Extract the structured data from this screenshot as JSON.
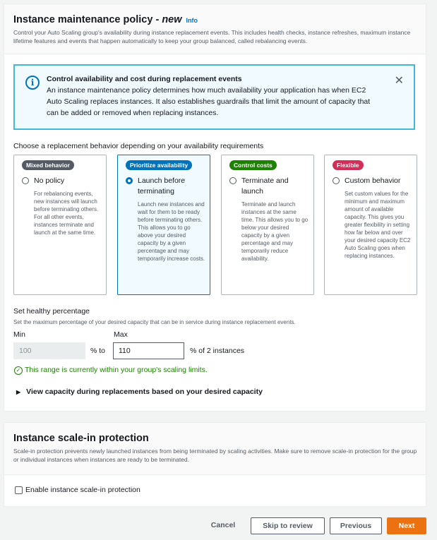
{
  "maintenance": {
    "title": "Instance maintenance policy - ",
    "title_new": "new",
    "info_link": "Info",
    "description": "Control your Auto Scaling group's availability during instance replacement events. This includes health checks, instance refreshes, maximum instance lifetime features and events that happen automatically to keep your group balanced, called rebalancing events.",
    "alert": {
      "title": "Control availability and cost during replacement events",
      "body": "An instance maintenance policy determines how much availability your application has when EC2 Auto Scaling replaces instances. It also establishes guardrails that limit the amount of capacity that can be added or removed when replacing instances.",
      "close_glyph": "✕",
      "icon_glyph": "i"
    },
    "choose_label": "Choose a replacement behavior depending on your availability requirements",
    "options": [
      {
        "badge": "Mixed behavior",
        "badge_color": "#545b64",
        "title": "No policy",
        "description": "For rebalancing events, new instances will launch before terminating others. For all other events, instances terminate and launch at the same time.",
        "selected": false
      },
      {
        "badge": "Prioritize availability",
        "badge_color": "#0073bb",
        "title": "Launch before terminating",
        "description": "Launch new instances and wait for them to be ready before terminating others. This allows you to go above your desired capacity by a given percentage and may temporarily increase costs.",
        "selected": true
      },
      {
        "badge": "Control costs",
        "badge_color": "#1d8102",
        "title": "Terminate and launch",
        "description": "Terminate and launch instances at the same time. This allows you to go below your desired capacity by a given percentage and may temporarily reduce availability.",
        "selected": false
      },
      {
        "badge": "Flexible",
        "badge_color": "#d12f59",
        "title": "Custom behavior",
        "description": "Set custom values for the minimum and maximum amount of available capacity. This gives you greater flexibility in setting how far below and over your desired capacity EC2 Auto Scaling goes when replacing instances.",
        "selected": false
      }
    ],
    "healthy": {
      "label": "Set healthy percentage",
      "description": "Set the maximum percentage of your desired capacity that can be in service during instance replacement events.",
      "min_label": "Min",
      "max_label": "Max",
      "min_value": "100",
      "to_text": "% to",
      "max_value": "110",
      "of_text": "% of 2 instances",
      "status": "This range is currently within your group's scaling limits.",
      "status_glyph": "✓"
    },
    "expander": {
      "caret": "▶",
      "label": "View capacity during replacements based on your desired capacity"
    }
  },
  "scale_in": {
    "title": "Instance scale-in protection",
    "description": "Scale-in protection prevents newly launched instances from being terminated by scaling activities. Make sure to remove scale-in protection for the group or individual instances when instances are ready to be terminated.",
    "checkbox_label": "Enable instance scale-in protection",
    "checked": false
  },
  "footer": {
    "cancel": "Cancel",
    "skip": "Skip to review",
    "previous": "Previous",
    "next": "Next"
  }
}
